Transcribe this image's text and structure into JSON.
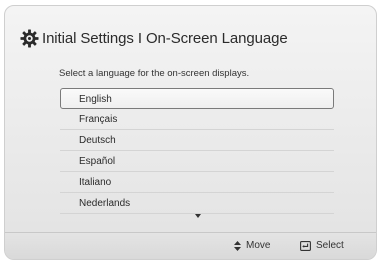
{
  "header": {
    "title": "Initial Settings I On-Screen Language",
    "icon": "gear-icon"
  },
  "prompt": "Select a language for the on-screen displays.",
  "languages": [
    {
      "label": "English",
      "selected": true
    },
    {
      "label": "Français",
      "selected": false
    },
    {
      "label": "Deutsch",
      "selected": false
    },
    {
      "label": "Español",
      "selected": false
    },
    {
      "label": "Italiano",
      "selected": false
    },
    {
      "label": "Nederlands",
      "selected": false
    }
  ],
  "scroll_indicator": "chevron-down-icon",
  "footer": {
    "move_label": "Move",
    "move_icon": "updown-arrows-icon",
    "select_label": "Select",
    "select_icon": "enter-icon"
  }
}
